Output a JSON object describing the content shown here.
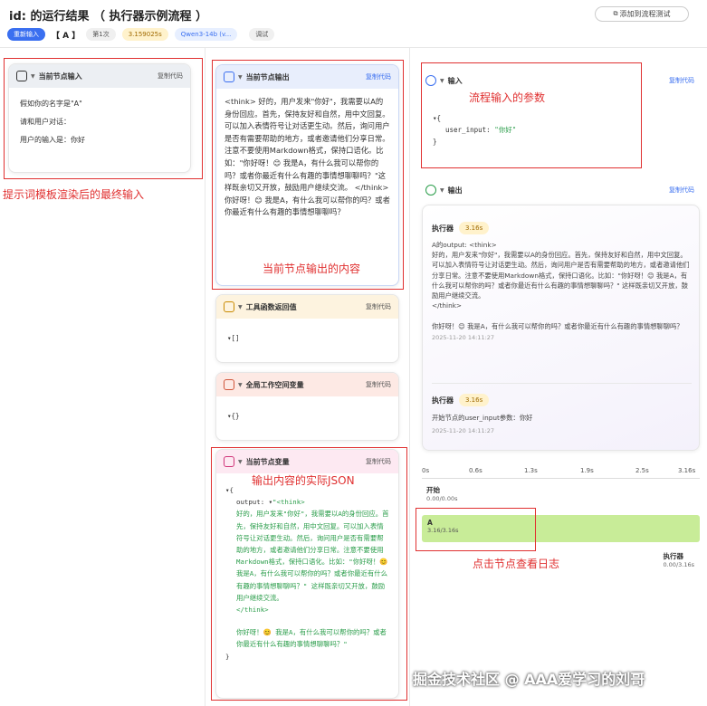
{
  "header": {
    "title": "id: 的运行结果 （ 执行器示例流程 ）",
    "add_test": "添加到流程测试"
  },
  "bar": {
    "rerun": "重新输入",
    "tag": "【 A 】",
    "count": "第1次",
    "time": "3.159025s",
    "model": "Qwen3-14b (v...",
    "debug": "调试"
  },
  "left": {
    "title": "当前节点输入",
    "copy": "复制代码",
    "lines": [
      "假如你的名字是\"A\"",
      "请和用户对话：",
      "用户的输入是：你好"
    ],
    "annotation": "提示词模板渲染后的最终输入"
  },
  "mid": {
    "output_title": "当前节点输出",
    "output_copy": "复制代码",
    "output_text": "<think> 好的，用户发来\"你好\"，我需要以A的身份回应。首先，保持友好和自然，用中文回复。可以加入表情符号让对话更生动。然后，询问用户是否有需要帮助的地方，或者邀请他们分享日常。注意不要使用Markdown格式，保持口语化。比如：\"你好呀！😊 我是A，有什么我可以帮你的吗？或者你最近有什么有趣的事情想聊聊吗？\"这样既亲切又开放，鼓励用户继续交流。 </think>\n你好呀！😊 我是A，有什么我可以帮你的吗？或者你最近有什么有趣的事情想聊聊吗？",
    "output_annotation": "当前节点输出的内容",
    "tool_title": "工具函数返回值",
    "tool_copy": "复制代码",
    "tool_body": "▾[]",
    "global_title": "全局工作空间变量",
    "global_copy": "复制代码",
    "global_body": "▾{}",
    "vars_title": "当前节点变量",
    "vars_copy": "复制代码",
    "vars_annotation": "输出内容的实际JSON",
    "vars_open": "▾{",
    "vars_key": "output: ▾",
    "vars_think_open": "\"<think>",
    "vars_text": "好的，用户发来\"你好\"，我需要以A的身份回应。首先，保持友好和自然，用中文回复。可以加入表情符号让对话更生动。然后，询问用户是否有需要帮助的地方，或者邀请他们分享日常。注意不要使用Markdown格式，保持口语化。比如：\"你好呀！😊 我是A，有什么我可以帮你的吗？或者你最近有什么有趣的事情想聊聊吗？\" 这样既亲切又开放，鼓励用户继续交流。",
    "vars_think_close": "</think>",
    "vars_reply": "你好呀！😊 我是A，有什么我可以帮你的吗？或者你最近有什么有趣的事情想聊聊吗？\"",
    "vars_close": "}"
  },
  "right": {
    "input_title": "输入",
    "input_copy": "复制代码",
    "input_annotation": "流程输入的参数",
    "input_open": "▾{",
    "input_key": "user_input:",
    "input_val": "\"你好\"",
    "input_close": "}",
    "output_title": "输出",
    "output_copy": "复制代码",
    "exec1": {
      "name": "执行器",
      "time": "3.16s",
      "text": "A的output: <think>\n好的，用户发来\"你好\"，我需要以A的身份回应。首先，保持友好和自然，用中文回复。可以加入表情符号让对话更生动。然后，询问用户是否有需要帮助的地方，或者邀请他们分享日常。注意不要使用Markdown格式，保持口语化。比如：\"你好呀！😊 我是A，有什么我可以帮你的吗？或者你最近有什么有趣的事情想聊聊吗？\" 这样既亲切又开放，鼓励用户继续交流。\n</think>",
      "reply": "你好呀！😊 我是A，有什么我可以帮你的吗？或者你最近有什么有趣的事情想聊聊吗？",
      "date": "2025-11-20 14:11:27"
    },
    "exec2": {
      "name": "执行器",
      "time": "3.16s",
      "text": "开始节点的user_input参数：你好",
      "date": "2025-11-20 14:11:27"
    }
  },
  "timeline": {
    "ticks": [
      "0s",
      "0.6s",
      "1.3s",
      "1.9s",
      "2.5s",
      "3.16s"
    ],
    "rows": [
      {
        "name": "开始",
        "time": "0.00/0.00s"
      },
      {
        "name": "A",
        "time": "3.16/3.16s"
      },
      {
        "name": "执行器",
        "time": "0.00/3.16s"
      }
    ],
    "annotation": "点击节点查看日志"
  },
  "watermark": "掘金技术社区 @ AAA爱学习的刘哥"
}
